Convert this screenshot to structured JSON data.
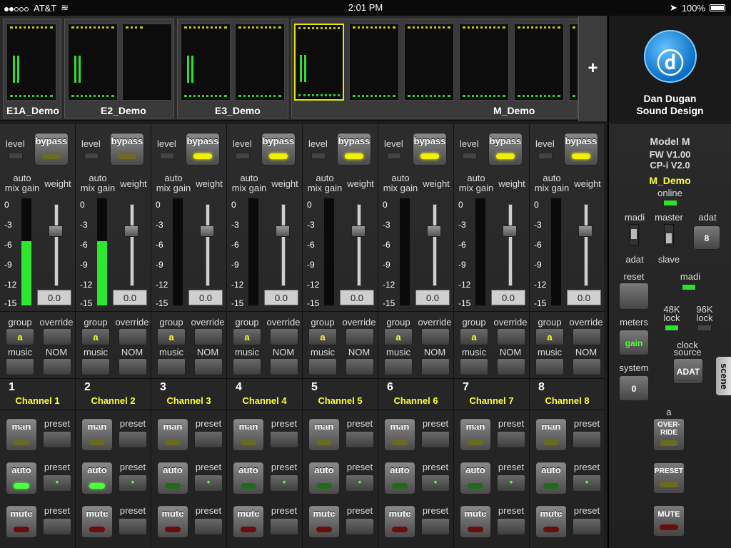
{
  "status": {
    "carrier": "AT&T",
    "time": "2:01 PM",
    "battery": "100%"
  },
  "overview": {
    "groups": [
      {
        "name": "E1A_Demo"
      },
      {
        "name": "E2_Demo"
      },
      {
        "name": "E3_Demo"
      },
      {
        "name": "M_Demo"
      }
    ],
    "add_label": "+"
  },
  "logo": {
    "line1": "Dan Dugan",
    "line2": "Sound Design"
  },
  "labels": {
    "level": "level",
    "bypass": "bypass",
    "auto_mix_gain_1": "auto",
    "auto_mix_gain_2": "mix gain",
    "weight": "weight",
    "group": "group",
    "override": "override",
    "music": "music",
    "nom": "NOM",
    "man": "man",
    "auto": "auto",
    "mute": "mute",
    "preset": "preset"
  },
  "scale": [
    "0",
    "-3",
    "-6",
    "-9",
    "-12",
    "-15"
  ],
  "channels": [
    {
      "num": "1",
      "name": "Channel 1",
      "weight": "0.0",
      "group": "a",
      "gain": 0.6,
      "auto_on": true
    },
    {
      "num": "2",
      "name": "Channel 2",
      "weight": "0.0",
      "group": "a",
      "gain": 0.6,
      "auto_on": true
    },
    {
      "num": "3",
      "name": "Channel 3",
      "weight": "0.0",
      "group": "a",
      "gain": 0,
      "auto_on": false
    },
    {
      "num": "4",
      "name": "Channel 4",
      "weight": "0.0",
      "group": "a",
      "gain": 0,
      "auto_on": false
    },
    {
      "num": "5",
      "name": "Channel 5",
      "weight": "0.0",
      "group": "a",
      "gain": 0,
      "auto_on": false
    },
    {
      "num": "6",
      "name": "Channel 6",
      "weight": "0.0",
      "group": "a",
      "gain": 0,
      "auto_on": false
    },
    {
      "num": "7",
      "name": "Channel 7",
      "weight": "0.0",
      "group": "a",
      "gain": 0,
      "auto_on": false
    },
    {
      "num": "8",
      "name": "Channel 8",
      "weight": "0.0",
      "group": "a",
      "gain": 0,
      "auto_on": false
    }
  ],
  "right": {
    "model": "Model M",
    "fw": "FW V1.00",
    "cpi": "CP-i V2.0",
    "device_name": "M_Demo",
    "online": "online",
    "madi": "madi",
    "adat_lbl": "adat",
    "master": "master",
    "slave": "slave",
    "adat_top": "adat",
    "adat_value": "8",
    "reset": "reset",
    "madi_led": "madi",
    "lock48": "48K",
    "lock48b": "lock",
    "lock96": "96K",
    "lock96b": "lock",
    "meters": "meters",
    "meters_value": "gain",
    "clock": "clock",
    "clock2": "source",
    "clock_value": "ADAT",
    "system": "system",
    "system_value": "0",
    "group_a": "a",
    "override_btn": "OVER-\nRIDE",
    "preset_btn": "PRESET",
    "mute_btn": "MUTE",
    "scene": "scene"
  },
  "colors": {
    "accent_yellow": "#f0f000",
    "green": "#2fe72f",
    "red": "#6a0d0d"
  }
}
